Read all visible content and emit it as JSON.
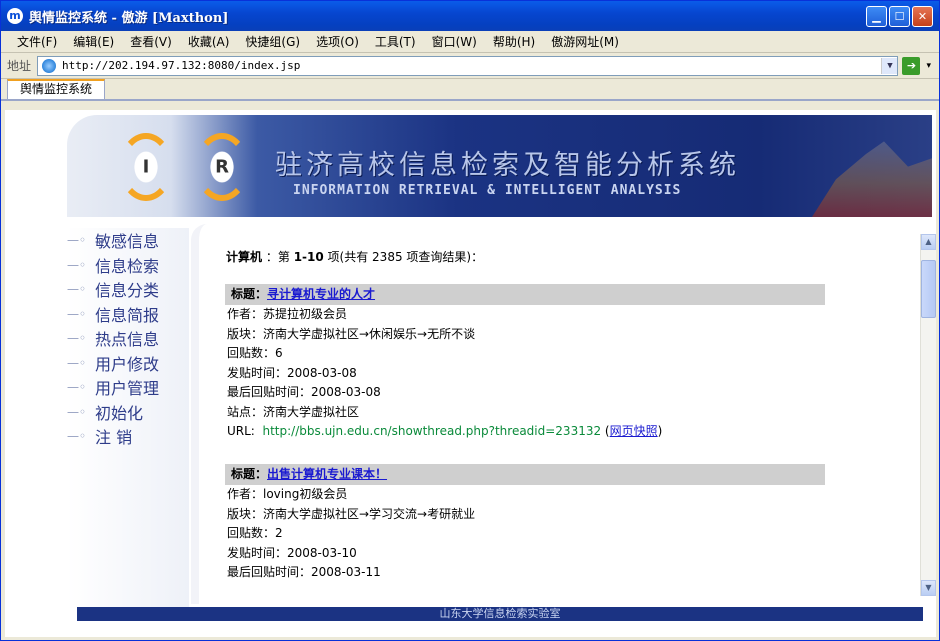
{
  "window": {
    "title": "舆情监控系统 - 傲游 [Maxthon]",
    "app_icon": "maxthon-icon",
    "buttons": [
      "minimize",
      "maximize",
      "close"
    ]
  },
  "menubar": {
    "items": [
      "文件(F)",
      "编辑(E)",
      "查看(V)",
      "收藏(A)",
      "快捷组(G)",
      "选项(O)",
      "工具(T)",
      "窗口(W)",
      "帮助(H)",
      "傲游网址(M)"
    ]
  },
  "addressbar": {
    "label": "地址",
    "url": "http://202.194.97.132:8080/index.jsp"
  },
  "tabs": [
    {
      "label": "舆情监控系统",
      "active": true
    }
  ],
  "banner": {
    "logo_letters": [
      "I",
      "R"
    ],
    "title_cn": "驻济高校信息检索及智能分析系统",
    "title_en": "INFORMATION RETRIEVAL & INTELLIGENT ANALYSIS"
  },
  "nav": {
    "items": [
      "敏感信息",
      "信息检索",
      "信息分类",
      "信息简报",
      "热点信息",
      "用户修改",
      "用户管理",
      "初始化",
      "注 销"
    ]
  },
  "results": {
    "keyword": "计算机",
    "prefix": "：第",
    "range": "1-10",
    "suffix": "项(共有 2385 项查询结果)："
  },
  "records": [
    {
      "title_label": "标题：",
      "title": "寻计算机专业的人才",
      "author": "作者：苏提拉初级会员",
      "board": "版块：济南大学虚拟社区→休闲娱乐→无所不谈",
      "replies": "回贴数：6",
      "posted": "发贴时间：2008-03-08",
      "last_reply": "最后回贴时间：2008-03-08",
      "site": "站点：济南大学虚拟社区",
      "url_label": "URL:",
      "url": "http://bbs.ujn.edu.cn/showthread.php?threadid=233132",
      "snapshot": "网页快照"
    },
    {
      "title_label": "标题：",
      "title": "出售计算机专业课本！",
      "author": "作者：loving初级会员",
      "board": "版块：济南大学虚拟社区→学习交流→考研就业",
      "replies": "回贴数：2",
      "posted": "发贴时间：2008-03-10",
      "last_reply": "最后回贴时间：2008-03-11"
    }
  ],
  "footer": "山东大学信息检索实验室"
}
